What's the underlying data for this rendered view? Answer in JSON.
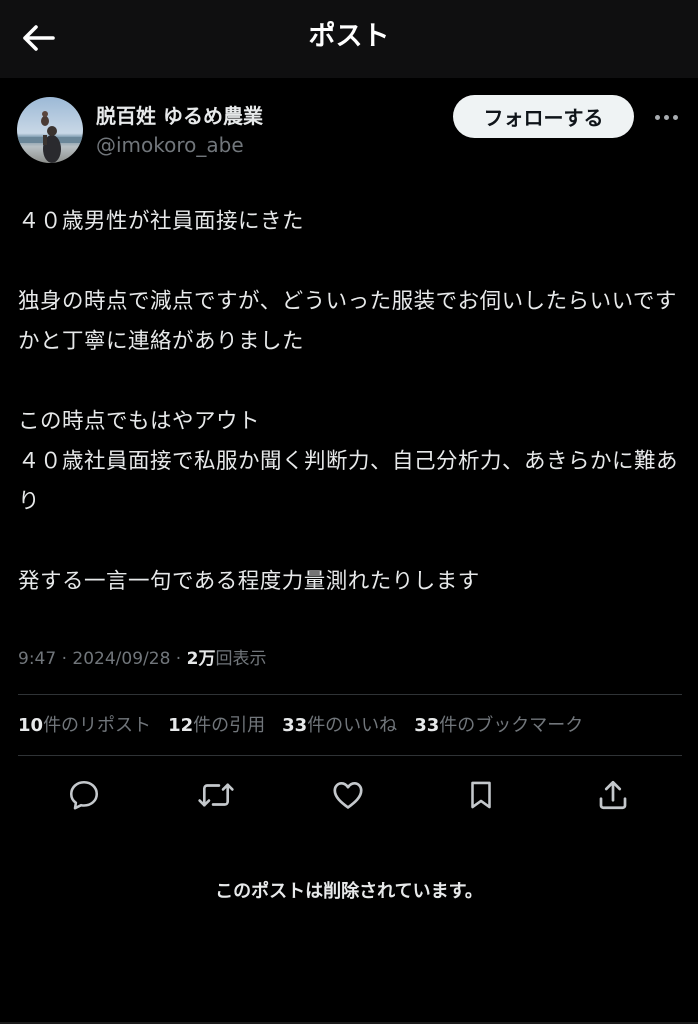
{
  "header": {
    "title": "ポスト",
    "back_icon": "arrow-left-icon"
  },
  "author": {
    "display_name": "脱百姓 ゆるめ農業",
    "handle": "@imokoro_abe",
    "follow_label": "フォローする",
    "more_icon": "more-horizontal-icon"
  },
  "post": {
    "text": "４０歳男性が社員面接にきた\n\n独身の時点で減点ですが、どういった服装でお伺いしたらいいですかと丁寧に連絡がありました\n\nこの時点でもはやアウト\n４０歳社員面接で私服か聞く判断力、自己分析力、あきらかに難あり\n\n発する一言一句である程度力量測れたりします",
    "time": "9:47",
    "date": "2024/09/28",
    "separator": " · ",
    "views_count": "2万",
    "views_label": "回表示"
  },
  "stats": [
    {
      "count": "10",
      "label": "件のリポスト"
    },
    {
      "count": "12",
      "label": "件の引用"
    },
    {
      "count": "33",
      "label": "件のいいね"
    },
    {
      "count": "33",
      "label": "件のブックマーク"
    }
  ],
  "actions": {
    "reply_icon": "reply-icon",
    "repost_icon": "repost-icon",
    "like_icon": "heart-icon",
    "bookmark_icon": "bookmark-icon",
    "share_icon": "share-icon"
  },
  "notice": {
    "deleted_text": "このポストは削除されています。"
  },
  "colors": {
    "background": "#000000",
    "header_background": "#0f0f10",
    "primary_text": "#e7e9ea",
    "secondary_text": "#71767b",
    "divider": "#2f3336",
    "follow_button": "#eff3f4"
  }
}
